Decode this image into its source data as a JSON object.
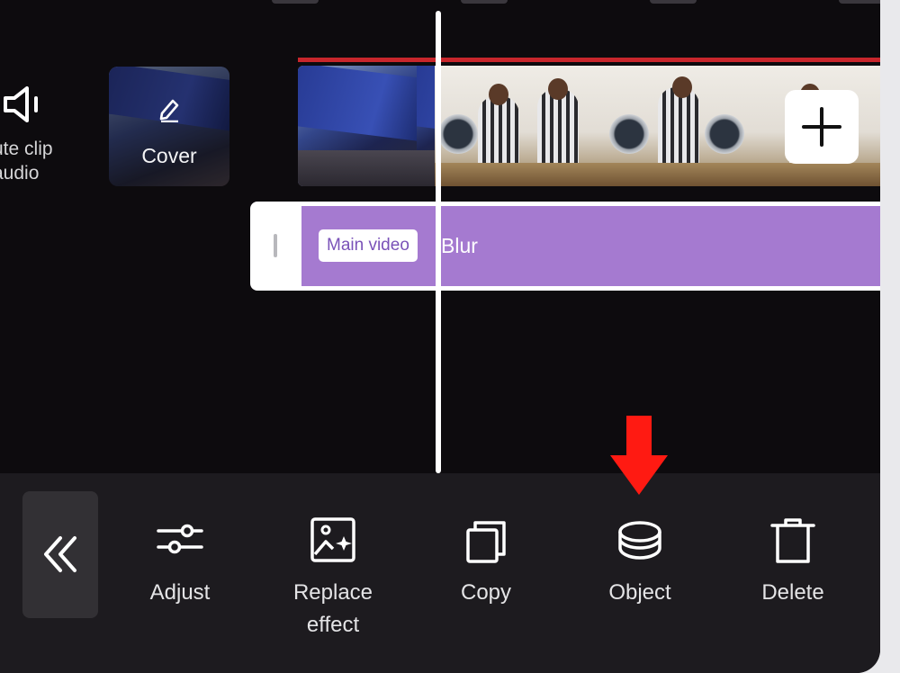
{
  "timeline": {
    "mute_label": "ute clip\naudio",
    "cover_label": "Cover",
    "effect_badge": "Main video",
    "effect_name": "Blur"
  },
  "toolbar": {
    "tools": [
      {
        "label": "Adjust",
        "icon": "sliders-icon"
      },
      {
        "label": "Replace\neffect",
        "icon": "image-sparkle-icon"
      },
      {
        "label": "Copy",
        "icon": "copy-icon"
      },
      {
        "label": "Object",
        "icon": "layers-icon"
      },
      {
        "label": "Delete",
        "icon": "trash-icon"
      }
    ]
  },
  "colors": {
    "background": "#0d0b0e",
    "toolbar": "#1d1b1f",
    "effect_track": "#a57ad0",
    "badge_text": "#7a52b8",
    "clip_top_line": "#c8262c",
    "annotation_arrow": "#ff1a12"
  }
}
